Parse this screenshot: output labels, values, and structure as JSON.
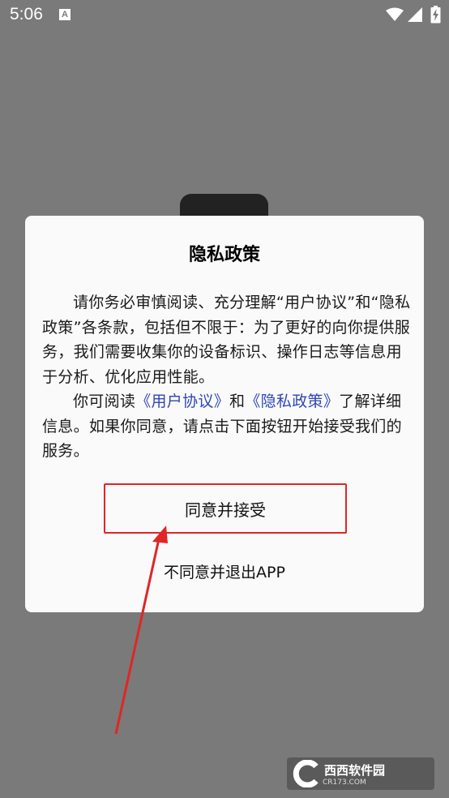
{
  "status_bar": {
    "time": "5:06",
    "notification_icon_letter": "A",
    "icons": [
      "wifi-icon",
      "signal-icon",
      "battery-charging-icon"
    ]
  },
  "dialog": {
    "title": "隐私政策",
    "paragraph1": "请你务必审慎阅读、充分理解“用户协议”和“隐私政策”各条款，包括但不限于：为了更好的向你提供服务，我们需要收集你的设备标识、操作日志等信息用于分析、优化应用性能。",
    "paragraph2_prefix": "你可阅读",
    "user_agreement_link": "《用户协议》",
    "paragraph2_and": "和",
    "privacy_policy_link": "《隐私政策》",
    "paragraph2_suffix": "了解详细信息。如果你同意，请点击下面按钮开始接受我们的服务。",
    "accept_label": "同意并接受",
    "decline_label": "不同意并退出APP"
  },
  "annotation": {
    "color": "#e02626",
    "type": "arrow pointing to accept button"
  },
  "watermark": {
    "brand": "西西软件园",
    "domain": "CR173.COM"
  },
  "colors": {
    "overlay": "#7a7a7a",
    "dialog_bg": "#fafafa",
    "link": "#2f46b4",
    "highlight": "#e02626"
  }
}
